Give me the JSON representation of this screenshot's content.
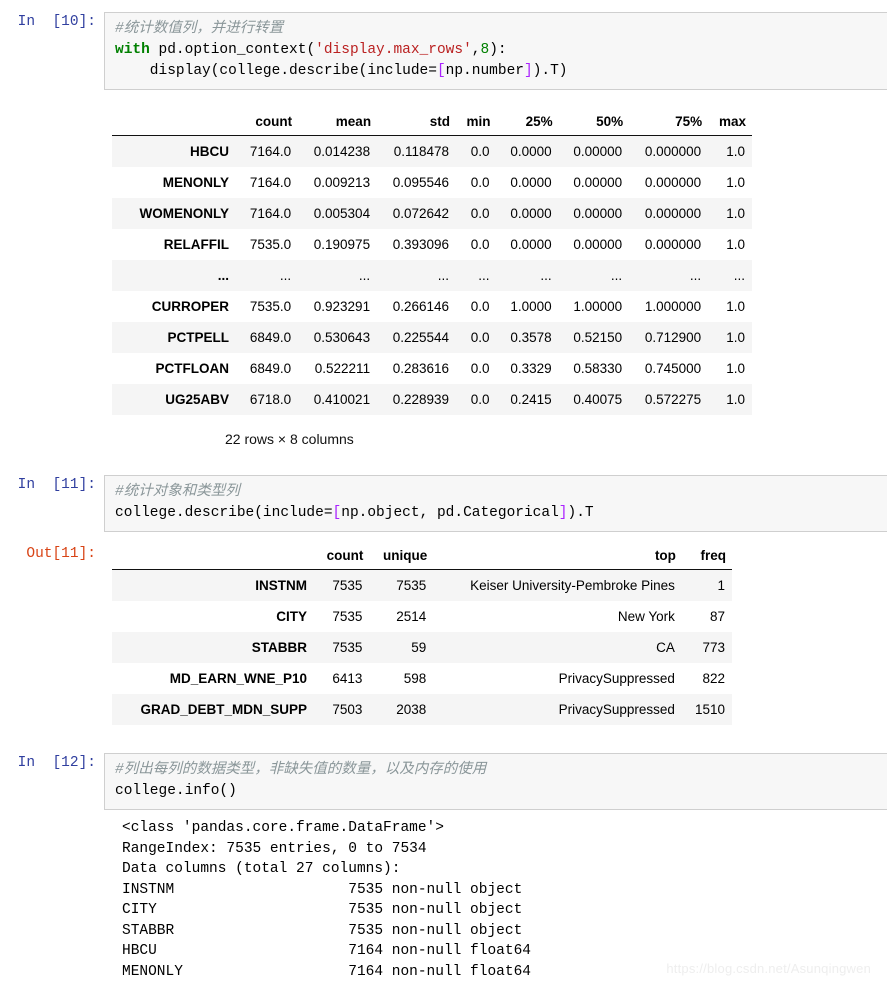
{
  "cells": [
    {
      "prompt": "In  [10]:",
      "code_lines": [
        [
          {
            "t": "comment",
            "s": "#统计数值列，并进行转置"
          }
        ],
        [
          {
            "t": "kw",
            "s": "with"
          },
          {
            "t": "plain",
            "s": " pd.option_context("
          },
          {
            "t": "str",
            "s": "'display.max_rows'"
          },
          {
            "t": "plain",
            "s": ","
          },
          {
            "t": "num",
            "s": "8"
          },
          {
            "t": "plain",
            "s": "):"
          }
        ],
        [
          {
            "t": "plain",
            "s": "    display(college.describe(include="
          },
          {
            "t": "op",
            "s": "["
          },
          {
            "t": "plain",
            "s": "np.number"
          },
          {
            "t": "op",
            "s": "]"
          },
          {
            "t": "plain",
            "s": ").T)"
          }
        ]
      ]
    },
    {
      "prompt": "In  [11]:",
      "code_lines": [
        [
          {
            "t": "comment",
            "s": "#统计对象和类型列"
          }
        ],
        [
          {
            "t": "plain",
            "s": "college.describe(include="
          },
          {
            "t": "op",
            "s": "["
          },
          {
            "t": "plain",
            "s": "np.object, pd.Categorical"
          },
          {
            "t": "op",
            "s": "]"
          },
          {
            "t": "plain",
            "s": ").T"
          }
        ]
      ]
    },
    {
      "prompt": "In  [12]:",
      "code_lines": [
        [
          {
            "t": "comment",
            "s": "#列出每列的数据类型，非缺失值的数量，以及内存的使用"
          }
        ],
        [
          {
            "t": "plain",
            "s": "college.info()"
          }
        ]
      ]
    }
  ],
  "out_prompt_11": "Out[11]:",
  "table_numeric": {
    "corner": "",
    "columns": [
      "count",
      "mean",
      "std",
      "min",
      "25%",
      "50%",
      "75%",
      "max"
    ],
    "rows": [
      {
        "index": "HBCU",
        "cells": [
          "7164.0",
          "0.014238",
          "0.118478",
          "0.0",
          "0.0000",
          "0.00000",
          "0.000000",
          "1.0"
        ]
      },
      {
        "index": "MENONLY",
        "cells": [
          "7164.0",
          "0.009213",
          "0.095546",
          "0.0",
          "0.0000",
          "0.00000",
          "0.000000",
          "1.0"
        ]
      },
      {
        "index": "WOMENONLY",
        "cells": [
          "7164.0",
          "0.005304",
          "0.072642",
          "0.0",
          "0.0000",
          "0.00000",
          "0.000000",
          "1.0"
        ]
      },
      {
        "index": "RELAFFIL",
        "cells": [
          "7535.0",
          "0.190975",
          "0.393096",
          "0.0",
          "0.0000",
          "0.00000",
          "0.000000",
          "1.0"
        ]
      },
      {
        "index": "...",
        "cells": [
          "...",
          "...",
          "...",
          "...",
          "...",
          "...",
          "...",
          "..."
        ]
      },
      {
        "index": "CURROPER",
        "cells": [
          "7535.0",
          "0.923291",
          "0.266146",
          "0.0",
          "1.0000",
          "1.00000",
          "1.000000",
          "1.0"
        ]
      },
      {
        "index": "PCTPELL",
        "cells": [
          "6849.0",
          "0.530643",
          "0.225544",
          "0.0",
          "0.3578",
          "0.52150",
          "0.712900",
          "1.0"
        ]
      },
      {
        "index": "PCTFLOAN",
        "cells": [
          "6849.0",
          "0.522211",
          "0.283616",
          "0.0",
          "0.3329",
          "0.58330",
          "0.745000",
          "1.0"
        ]
      },
      {
        "index": "UG25ABV",
        "cells": [
          "6718.0",
          "0.410021",
          "0.228939",
          "0.0",
          "0.2415",
          "0.40075",
          "0.572275",
          "1.0"
        ]
      }
    ],
    "shape_note": "22 rows × 8 columns"
  },
  "table_object": {
    "corner": "",
    "columns": [
      "count",
      "unique",
      "top",
      "freq"
    ],
    "rows": [
      {
        "index": "INSTNM",
        "cells": [
          "7535",
          "7535",
          "Keiser University-Pembroke Pines",
          "1"
        ]
      },
      {
        "index": "CITY",
        "cells": [
          "7535",
          "2514",
          "New York",
          "87"
        ]
      },
      {
        "index": "STABBR",
        "cells": [
          "7535",
          "59",
          "CA",
          "773"
        ]
      },
      {
        "index": "MD_EARN_WNE_P10",
        "cells": [
          "6413",
          "598",
          "PrivacySuppressed",
          "822"
        ]
      },
      {
        "index": "GRAD_DEBT_MDN_SUPP",
        "cells": [
          "7503",
          "2038",
          "PrivacySuppressed",
          "1510"
        ]
      }
    ]
  },
  "info_output": "<class 'pandas.core.frame.DataFrame'>\nRangeIndex: 7535 entries, 0 to 7534\nData columns (total 27 columns):\nINSTNM                    7535 non-null object\nCITY                      7535 non-null object\nSTABBR                    7535 non-null object\nHBCU                      7164 non-null float64\nMENONLY                   7164 non-null float64",
  "watermark": "https://blog.csdn.net/Asunqingwen"
}
